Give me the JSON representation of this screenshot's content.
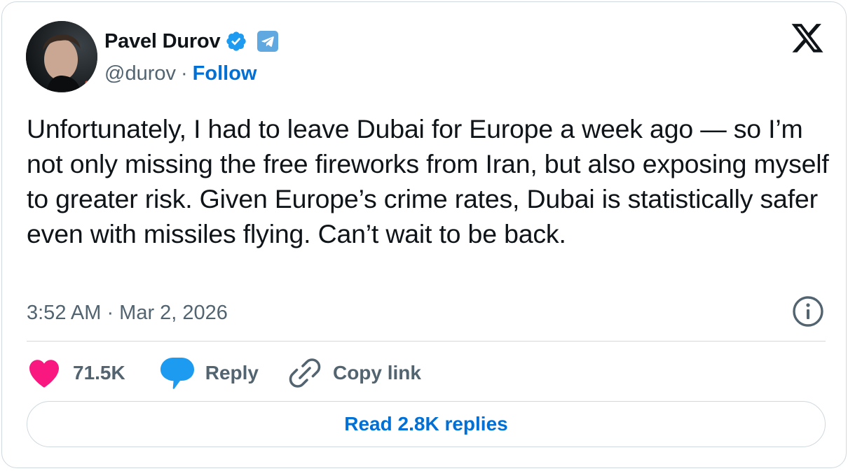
{
  "author": {
    "display_name": "Pavel Durov",
    "handle": "@durov",
    "separator": "·",
    "follow_label": "Follow",
    "verified_icon": "verified-badge-icon",
    "affiliate_icon": "telegram-icon"
  },
  "brand": {
    "logo": "x-logo-icon",
    "accent": "#006fd6",
    "like_color": "#f91880",
    "reply_color": "#1d9bf0"
  },
  "tweet": {
    "text": "Unfortunately, I had to leave Dubai for Europe a week ago — so I’m not only missing the free fireworks from Iran, but also exposing myself to greater risk. Given Europe’s crime rates, Dubai is statistically safer even with missiles flying. Can’t wait to be back.",
    "timestamp": "3:52 AM · Mar 2, 2026"
  },
  "actions": {
    "like_count": "71.5K",
    "reply_label": "Reply",
    "copy_link_label": "Copy link"
  },
  "footer": {
    "read_replies_label": "Read 2.8K replies"
  }
}
